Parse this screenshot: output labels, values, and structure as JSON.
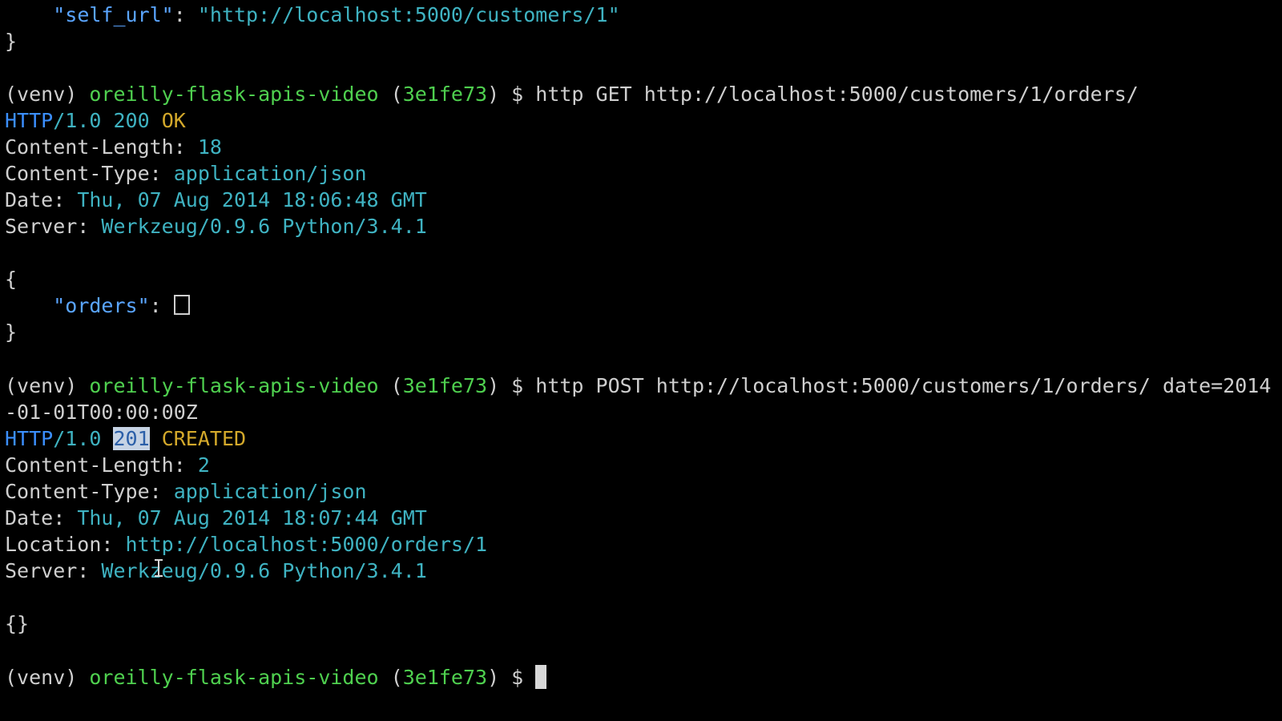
{
  "colors": {
    "background": "#000000",
    "plain_text": "#cfcfcf",
    "json_key": "#5aa5ff",
    "json_string": "#3fb3c2",
    "header_value": "#3fb3c2",
    "prompt_dir": "#4fd04f",
    "status_text": "#d4a92b",
    "http_version": "#3b8fff"
  },
  "previous_output": {
    "self_url_key": "\"self_url\"",
    "colon": ": ",
    "self_url_value": "\"http://localhost:5000/customers/1\"",
    "close_brace": "}"
  },
  "prompt": {
    "venv": "(venv) ",
    "dir": "oreilly-flask-apis-video",
    "branch_open": " (",
    "branch": "3e1fe73",
    "branch_close": ") $ "
  },
  "get_block": {
    "command": "http GET http://localhost:5000/customers/1/orders/",
    "status_proto": "HTTP",
    "status_version": "/1.0 200 ",
    "status_text": "OK",
    "headers": [
      {
        "name": "Content-Length: ",
        "value": "18"
      },
      {
        "name": "Content-Type: ",
        "value": "application/json"
      },
      {
        "name": "Date: ",
        "value": "Thu, 07 Aug 2014 18:06:48 GMT"
      },
      {
        "name": "Server: ",
        "value": "Werkzeug/0.9.6 Python/3.4.1"
      }
    ],
    "body_open": "{",
    "orders_key": "\"orders\"",
    "orders_colon": ": ",
    "body_close": "}"
  },
  "post_block": {
    "command_line1": "http POST http://localhost:5000/customers/1/orders/ date=2014",
    "command_line2": "-01-01T00:00:00Z",
    "status_proto": "HTTP",
    "status_version": "/1.0 ",
    "status_code": "201",
    "status_text": " CREATED",
    "headers": [
      {
        "name": "Content-Length: ",
        "value": "2"
      },
      {
        "name": "Content-Type: ",
        "value": "application/json"
      },
      {
        "name": "Date: ",
        "value": "Thu, 07 Aug 2014 18:07:44 GMT"
      },
      {
        "name": "Location: ",
        "value": "http://localhost:5000/orders/1"
      },
      {
        "name": "Server: ",
        "value": "Werkzeug/0.9.6 Python/3.4.1"
      }
    ],
    "body": "{}"
  }
}
